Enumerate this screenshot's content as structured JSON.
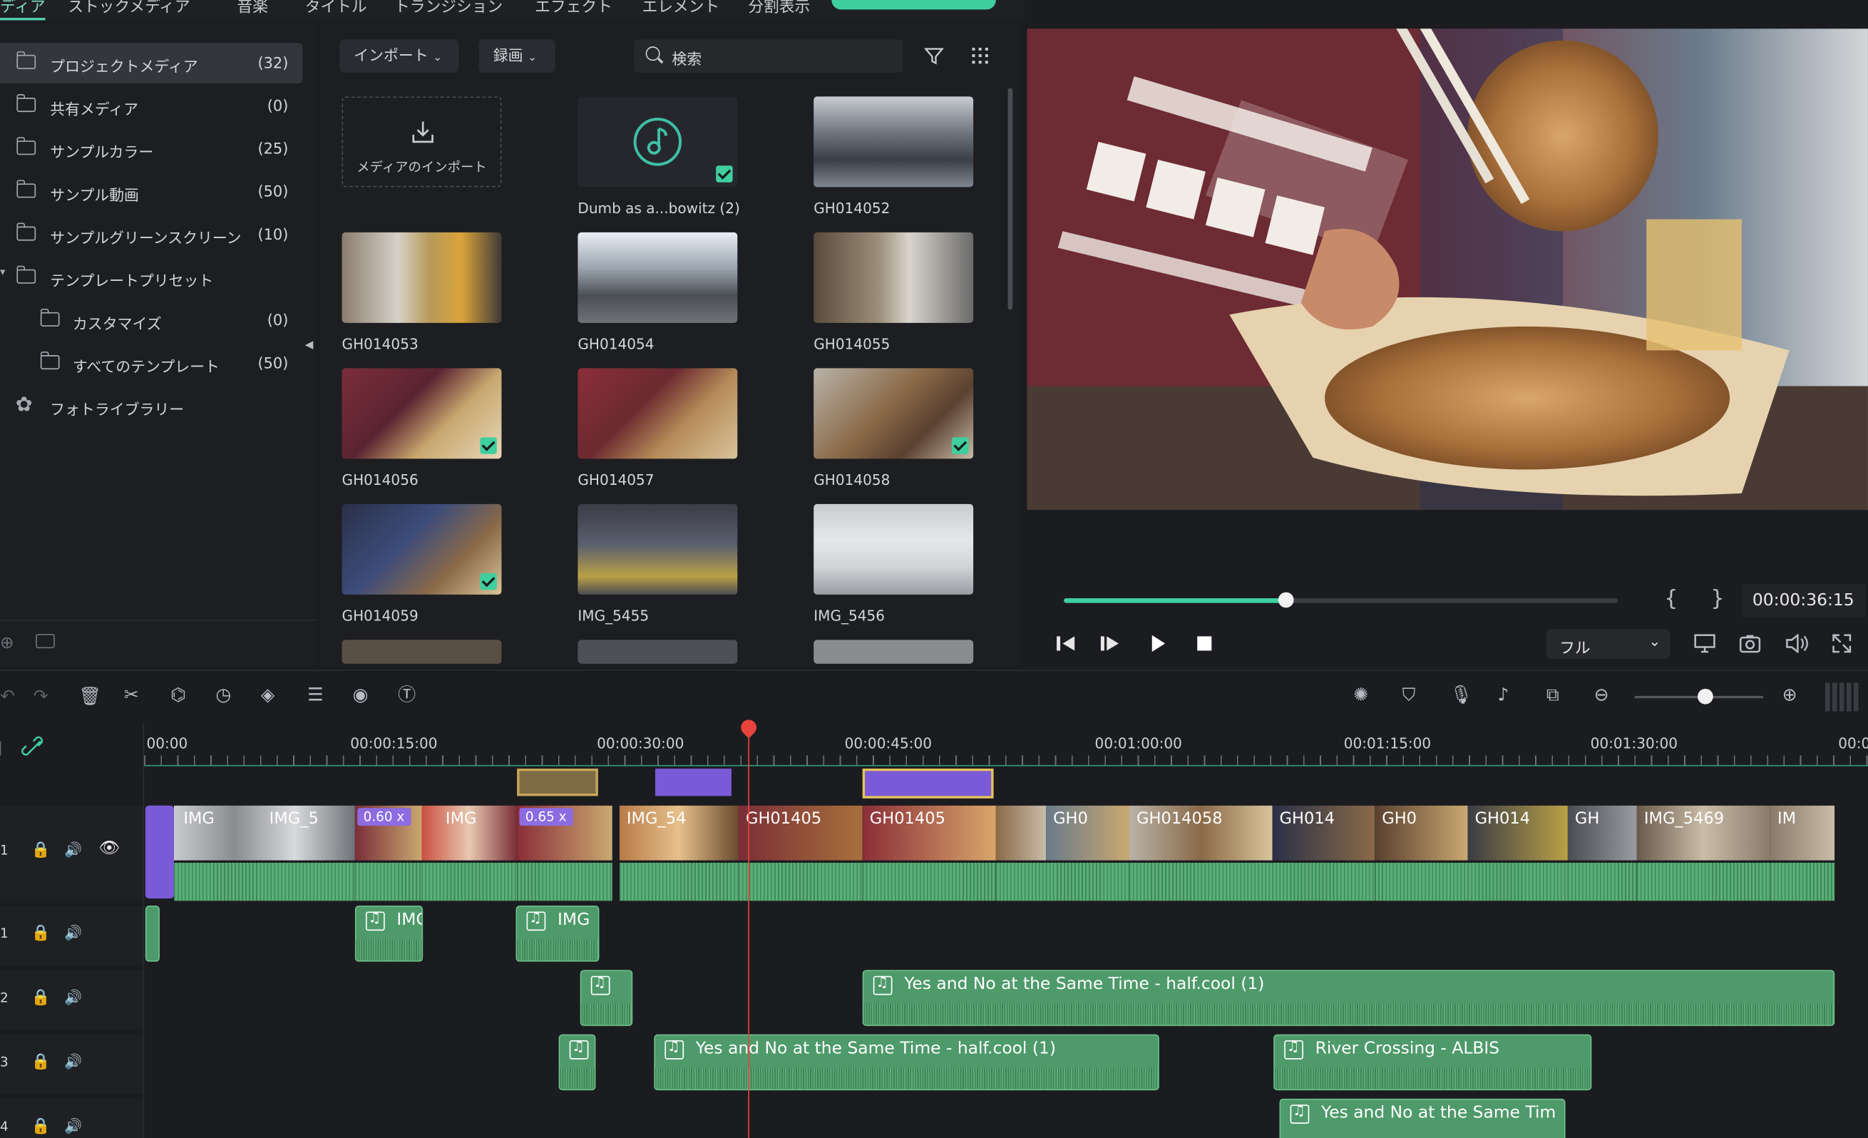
{
  "tabs": [
    "ディア",
    "ストックメディア",
    "音楽",
    "タイトル",
    "トランジション",
    "エフェクト",
    "エレメント",
    "分割表示"
  ],
  "sidebar": {
    "items": [
      {
        "label": "プロジェクトメディア",
        "count": "(32)"
      },
      {
        "label": "共有メディア",
        "count": "(0)"
      },
      {
        "label": "サンプルカラー",
        "count": "(25)"
      },
      {
        "label": "サンプル動画",
        "count": "(50)"
      },
      {
        "label": "サンプルグリーンスクリーン",
        "count": "(10)"
      },
      {
        "label": "テンプレートプリセット",
        "count": ""
      },
      {
        "label": "カスタマイズ",
        "count": "(0)"
      },
      {
        "label": "すべてのテンプレート",
        "count": "(50)"
      },
      {
        "label": "フォトライブラリー",
        "count": ""
      }
    ]
  },
  "media": {
    "import_label": "インポート",
    "record_label": "録画",
    "search_placeholder": "検索",
    "import_tile_label": "メディアのインポート",
    "items": [
      {
        "name": "Dumb as a...bowitz (2)"
      },
      {
        "name": "GH014052"
      },
      {
        "name": "GH014053"
      },
      {
        "name": "GH014054"
      },
      {
        "name": "GH014055"
      },
      {
        "name": "GH014056"
      },
      {
        "name": "GH014057"
      },
      {
        "name": "GH014058"
      },
      {
        "name": "GH014059"
      },
      {
        "name": "IMG_5455"
      },
      {
        "name": "IMG_5456"
      }
    ]
  },
  "player": {
    "timecode": "00:00:36:15",
    "progress": 0.4,
    "quality": "フル",
    "mark_in": "{",
    "mark_out": "}"
  },
  "timeline": {
    "ruler": [
      "00:00",
      "00:00:15:00",
      "00:00:30:00",
      "00:00:45:00",
      "00:01:00:00",
      "00:01:15:00",
      "00:01:30:00",
      "00:0"
    ],
    "tracks": [
      "1",
      "1",
      "2",
      "3",
      "4"
    ],
    "video_clips": [
      "IMG",
      "IMG_5",
      "IMG",
      "IMG_54",
      "GH01405",
      "GH01405",
      "GH0",
      "GH014058",
      "GH014",
      "GH0",
      "GH014",
      "GH",
      "IMG_5469",
      "IM"
    ],
    "speed_badges": [
      "0.60 x",
      "0.65 x"
    ],
    "audio": {
      "a1_clips": [
        "IMG",
        "IMG"
      ],
      "a2_main": "Yes and No at the Same Time - half.cool (1)",
      "a3_main": "Yes and No at the Same Time - half.cool (1)",
      "a3_second": "River Crossing - ALBIS",
      "a4_main": "Yes and No at the Same Tim"
    }
  },
  "colors": {
    "accent": "#3fcf9e",
    "playhead": "#e8443c",
    "clip_purple": "#7a5ad6",
    "audio_green": "#4e9a6a"
  }
}
